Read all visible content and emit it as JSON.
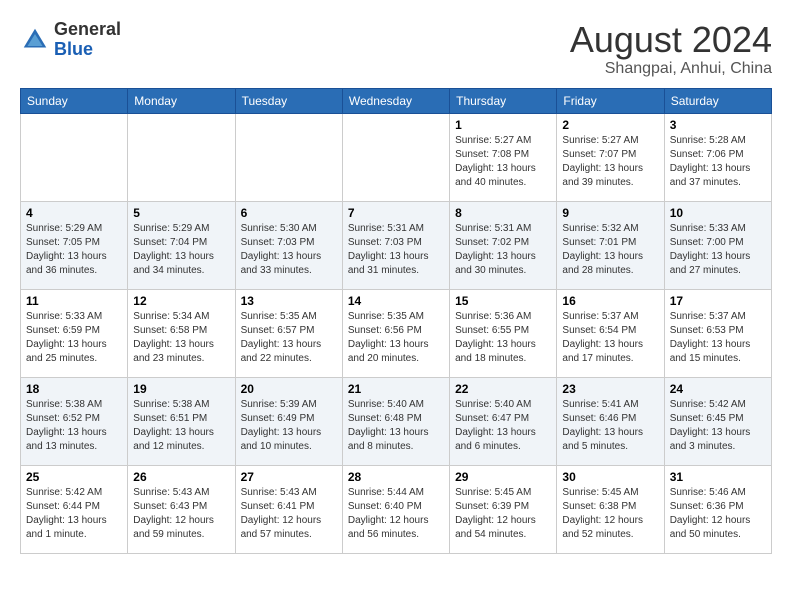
{
  "header": {
    "logo_line1": "General",
    "logo_line2": "Blue",
    "month_title": "August 2024",
    "location": "Shangpai, Anhui, China"
  },
  "weekdays": [
    "Sunday",
    "Monday",
    "Tuesday",
    "Wednesday",
    "Thursday",
    "Friday",
    "Saturday"
  ],
  "weeks": [
    [
      {
        "day": "",
        "info": ""
      },
      {
        "day": "",
        "info": ""
      },
      {
        "day": "",
        "info": ""
      },
      {
        "day": "",
        "info": ""
      },
      {
        "day": "1",
        "info": "Sunrise: 5:27 AM\nSunset: 7:08 PM\nDaylight: 13 hours\nand 40 minutes."
      },
      {
        "day": "2",
        "info": "Sunrise: 5:27 AM\nSunset: 7:07 PM\nDaylight: 13 hours\nand 39 minutes."
      },
      {
        "day": "3",
        "info": "Sunrise: 5:28 AM\nSunset: 7:06 PM\nDaylight: 13 hours\nand 37 minutes."
      }
    ],
    [
      {
        "day": "4",
        "info": "Sunrise: 5:29 AM\nSunset: 7:05 PM\nDaylight: 13 hours\nand 36 minutes."
      },
      {
        "day": "5",
        "info": "Sunrise: 5:29 AM\nSunset: 7:04 PM\nDaylight: 13 hours\nand 34 minutes."
      },
      {
        "day": "6",
        "info": "Sunrise: 5:30 AM\nSunset: 7:03 PM\nDaylight: 13 hours\nand 33 minutes."
      },
      {
        "day": "7",
        "info": "Sunrise: 5:31 AM\nSunset: 7:03 PM\nDaylight: 13 hours\nand 31 minutes."
      },
      {
        "day": "8",
        "info": "Sunrise: 5:31 AM\nSunset: 7:02 PM\nDaylight: 13 hours\nand 30 minutes."
      },
      {
        "day": "9",
        "info": "Sunrise: 5:32 AM\nSunset: 7:01 PM\nDaylight: 13 hours\nand 28 minutes."
      },
      {
        "day": "10",
        "info": "Sunrise: 5:33 AM\nSunset: 7:00 PM\nDaylight: 13 hours\nand 27 minutes."
      }
    ],
    [
      {
        "day": "11",
        "info": "Sunrise: 5:33 AM\nSunset: 6:59 PM\nDaylight: 13 hours\nand 25 minutes."
      },
      {
        "day": "12",
        "info": "Sunrise: 5:34 AM\nSunset: 6:58 PM\nDaylight: 13 hours\nand 23 minutes."
      },
      {
        "day": "13",
        "info": "Sunrise: 5:35 AM\nSunset: 6:57 PM\nDaylight: 13 hours\nand 22 minutes."
      },
      {
        "day": "14",
        "info": "Sunrise: 5:35 AM\nSunset: 6:56 PM\nDaylight: 13 hours\nand 20 minutes."
      },
      {
        "day": "15",
        "info": "Sunrise: 5:36 AM\nSunset: 6:55 PM\nDaylight: 13 hours\nand 18 minutes."
      },
      {
        "day": "16",
        "info": "Sunrise: 5:37 AM\nSunset: 6:54 PM\nDaylight: 13 hours\nand 17 minutes."
      },
      {
        "day": "17",
        "info": "Sunrise: 5:37 AM\nSunset: 6:53 PM\nDaylight: 13 hours\nand 15 minutes."
      }
    ],
    [
      {
        "day": "18",
        "info": "Sunrise: 5:38 AM\nSunset: 6:52 PM\nDaylight: 13 hours\nand 13 minutes."
      },
      {
        "day": "19",
        "info": "Sunrise: 5:38 AM\nSunset: 6:51 PM\nDaylight: 13 hours\nand 12 minutes."
      },
      {
        "day": "20",
        "info": "Sunrise: 5:39 AM\nSunset: 6:49 PM\nDaylight: 13 hours\nand 10 minutes."
      },
      {
        "day": "21",
        "info": "Sunrise: 5:40 AM\nSunset: 6:48 PM\nDaylight: 13 hours\nand 8 minutes."
      },
      {
        "day": "22",
        "info": "Sunrise: 5:40 AM\nSunset: 6:47 PM\nDaylight: 13 hours\nand 6 minutes."
      },
      {
        "day": "23",
        "info": "Sunrise: 5:41 AM\nSunset: 6:46 PM\nDaylight: 13 hours\nand 5 minutes."
      },
      {
        "day": "24",
        "info": "Sunrise: 5:42 AM\nSunset: 6:45 PM\nDaylight: 13 hours\nand 3 minutes."
      }
    ],
    [
      {
        "day": "25",
        "info": "Sunrise: 5:42 AM\nSunset: 6:44 PM\nDaylight: 13 hours\nand 1 minute."
      },
      {
        "day": "26",
        "info": "Sunrise: 5:43 AM\nSunset: 6:43 PM\nDaylight: 12 hours\nand 59 minutes."
      },
      {
        "day": "27",
        "info": "Sunrise: 5:43 AM\nSunset: 6:41 PM\nDaylight: 12 hours\nand 57 minutes."
      },
      {
        "day": "28",
        "info": "Sunrise: 5:44 AM\nSunset: 6:40 PM\nDaylight: 12 hours\nand 56 minutes."
      },
      {
        "day": "29",
        "info": "Sunrise: 5:45 AM\nSunset: 6:39 PM\nDaylight: 12 hours\nand 54 minutes."
      },
      {
        "day": "30",
        "info": "Sunrise: 5:45 AM\nSunset: 6:38 PM\nDaylight: 12 hours\nand 52 minutes."
      },
      {
        "day": "31",
        "info": "Sunrise: 5:46 AM\nSunset: 6:36 PM\nDaylight: 12 hours\nand 50 minutes."
      }
    ]
  ]
}
